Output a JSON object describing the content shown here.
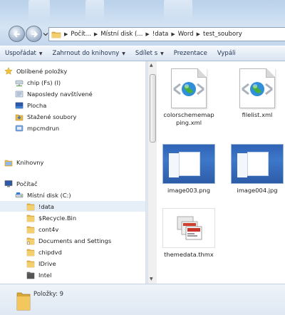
{
  "address": {
    "crumbs": [
      "Počít...",
      "Místní disk (...",
      "!data",
      "Word",
      "test_soubory"
    ]
  },
  "toolbar": {
    "items": [
      {
        "label": "Uspořádat",
        "dropdown": true
      },
      {
        "label": "Zahrnout do knihovny",
        "dropdown": true
      },
      {
        "label": "Sdílet s",
        "dropdown": true
      },
      {
        "label": "Prezentace",
        "dropdown": false
      },
      {
        "label": "Vypáli",
        "dropdown": false
      }
    ]
  },
  "nav": {
    "favorites_label": "Oblíbené položky",
    "favorites": [
      {
        "label": "chip (Fs) (I)",
        "icon": "network-drive-icon"
      },
      {
        "label": "Naposledy navštívené",
        "icon": "recent-places-icon"
      },
      {
        "label": "Plocha",
        "icon": "desktop-icon"
      },
      {
        "label": "Stažené soubory",
        "icon": "downloads-icon"
      },
      {
        "label": "mpcmdrun",
        "icon": "shortcut-folder-icon"
      }
    ],
    "libraries_label": "Knihovny",
    "computer_label": "Počítač",
    "drive_label": "Místní disk (C:)",
    "drive_items": [
      {
        "label": "!data",
        "selected": true
      },
      {
        "label": "$Recycle.Bin",
        "selected": false
      },
      {
        "label": "cont4v",
        "selected": false
      },
      {
        "label": "Documents and Settings",
        "selected": false
      },
      {
        "label": "chipdvd",
        "selected": false
      },
      {
        "label": "IDrive",
        "selected": false
      },
      {
        "label": "Intel",
        "selected": false
      }
    ]
  },
  "files": [
    {
      "name": "colorschememapping.xml",
      "line1": "colorschememap",
      "line2": "ping.xml",
      "kind": "xml"
    },
    {
      "name": "filelist.xml",
      "line1": "filelist.xml",
      "line2": "",
      "kind": "xml"
    },
    {
      "name": "image003.png",
      "line1": "image003.png",
      "line2": "",
      "kind": "image"
    },
    {
      "name": "image004.jpg",
      "line1": "image004.jpg",
      "line2": "",
      "kind": "image"
    },
    {
      "name": "themedata.thmx",
      "line1": "themedata.thmx",
      "line2": "",
      "kind": "theme"
    }
  ],
  "details": {
    "count_text": "Položky: 9"
  },
  "colors": {
    "selection": "#e6eef8",
    "folder": "#e8b84a",
    "globe": "#2f8fd8"
  }
}
